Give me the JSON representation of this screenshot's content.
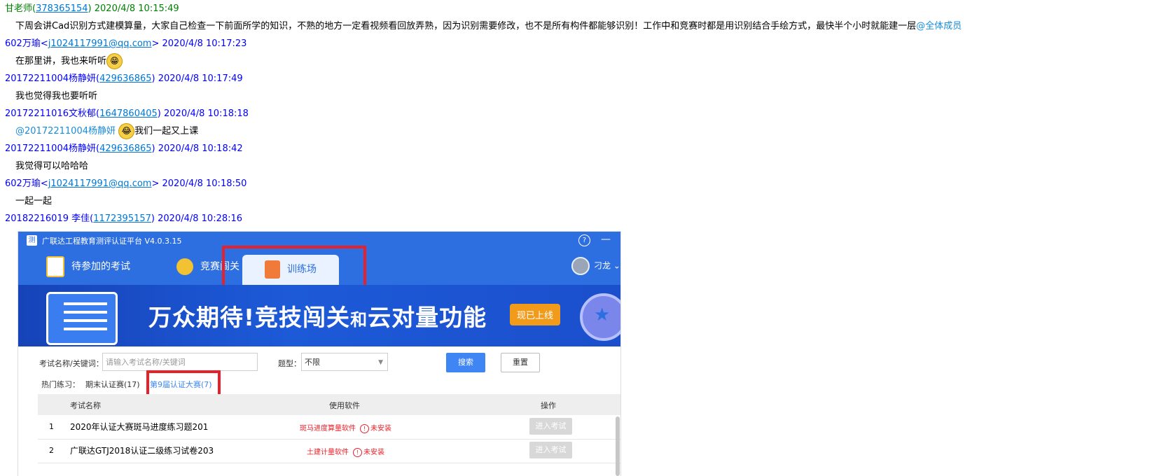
{
  "chat": [
    {
      "sender": "甘老师",
      "qq": "378365154",
      "time": "2020/4/8 10:15:49",
      "color": "green",
      "text": "下周会讲Cad识别方式建模算量，大家自己检查一下前面所学的知识，不熟的地方一定看视频看回放弄熟，因为识别需要修改，也不是所有构件都能够识别！工作中和竞赛时都是用识别结合手绘方式，最快半个小时就能建一层",
      "mention": "@全体成员"
    },
    {
      "sender": "602万瑜",
      "email": "j1024117991@qq.com",
      "time": "2020/4/8 10:17:23",
      "text": "在那里讲，我也来听听"
    },
    {
      "sender": "20172211004杨静妍",
      "qq": "429636865",
      "time": "2020/4/8 10:17:49",
      "text": "我也觉得我也要听听"
    },
    {
      "sender": "20172211016文秋郁",
      "qq": "1647860405",
      "time": "2020/4/8 10:18:18",
      "mention": "@20172211004杨静妍",
      "text": "我们一起又上课"
    },
    {
      "sender": "20172211004杨静妍",
      "qq": "429636865",
      "time": "2020/4/8 10:18:42",
      "text": "我觉得可以哈哈哈"
    },
    {
      "sender": "602万瑜",
      "email": "j1024117991@qq.com",
      "time": "2020/4/8 10:18:50",
      "text": "一起一起"
    },
    {
      "sender": "20182216019 李佳",
      "qq": "1172395157",
      "time": "2020/4/8 10:28:16"
    }
  ],
  "screenshot": {
    "app_title": "广联达工程教育测评认证平台 V4.0.3.15",
    "tabs": [
      "待参加的考试",
      "竞赛闯关",
      "训练场"
    ],
    "user_name": "刁龙",
    "banner_text_1": "万众期待!竞技闯关",
    "banner_text_and": "和",
    "banner_text_2": "云对量功能",
    "banner_badge": "现已上线",
    "filter_label": "考试名称/关键词：",
    "filter_placeholder": "请输入考试名称/关键词",
    "type_label": "题型：",
    "type_value": "不限",
    "search_button": "搜索",
    "reset_button": "重置",
    "hot_label": "热门练习：",
    "hot_items": [
      "期末认证赛(17)",
      "第9届认证大赛(7)"
    ],
    "table_headers": [
      "考试名称",
      "使用软件",
      "操作"
    ],
    "rows": [
      {
        "num": "1",
        "name": "2020年认证大赛斑马进度练习题201",
        "software": "斑马进度算量软件",
        "status": "未安装",
        "action": "进入考试"
      },
      {
        "num": "2",
        "name": "广联达GTJ2018认证二级练习试卷203",
        "software": "土建计量软件",
        "status": "未安装",
        "action": "进入考试"
      }
    ]
  }
}
